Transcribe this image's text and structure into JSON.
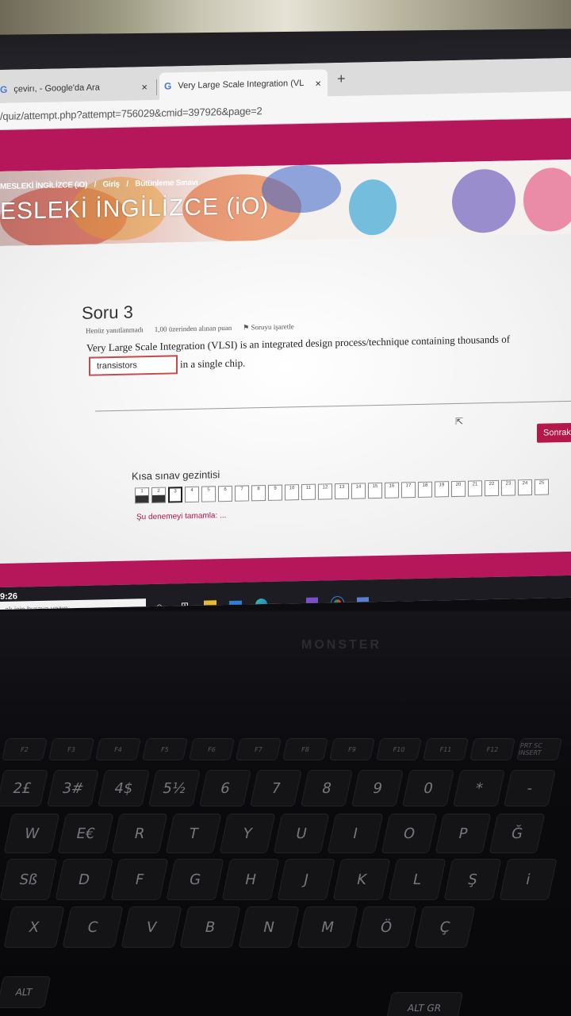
{
  "browser": {
    "tabs": [
      {
        "icon": "G",
        "label": "çevirı, - Google'da Ara",
        "close": "×"
      },
      {
        "icon": "G",
        "label": "Very Large Scale Integration (VLS",
        "close": "×"
      }
    ],
    "new_tab": "+",
    "url": "/quiz/attempt.php?attempt=756029&cmid=397926&page=2"
  },
  "course": {
    "breadcrumb": [
      "MESLEKİ İNGİLİZCE (iO)",
      "/",
      "Giriş",
      "/",
      "Bütünleme Sınavı"
    ],
    "title": "ESLEKİ İNGİLİZCE (iO)"
  },
  "question": {
    "title": "Soru 3",
    "status": "Henüz yanıtlanmadı",
    "points": "1,00 üzerinden alınan puan",
    "flag": "Soruyu işaretle",
    "text": "Very Large Scale Integration (VLSI) is an integrated design process/technique containing thousands of",
    "answer": "transistors",
    "text_after": "in a single chip."
  },
  "next_button": "Sonrak",
  "quiz_nav": {
    "title": "Kısa sınav gezintisi",
    "items": [
      {
        "n": "1",
        "state": "answered"
      },
      {
        "n": "2",
        "state": "answered"
      },
      {
        "n": "3",
        "state": "current"
      },
      {
        "n": "4",
        "state": "empty"
      },
      {
        "n": "5",
        "state": "empty"
      },
      {
        "n": "6",
        "state": "empty"
      },
      {
        "n": "7",
        "state": "empty"
      },
      {
        "n": "8",
        "state": "empty"
      },
      {
        "n": "9",
        "state": "empty"
      },
      {
        "n": "10",
        "state": "empty"
      },
      {
        "n": "11",
        "state": "empty"
      },
      {
        "n": "12",
        "state": "empty"
      },
      {
        "n": "13",
        "state": "empty"
      },
      {
        "n": "14",
        "state": "empty"
      },
      {
        "n": "15",
        "state": "empty"
      },
      {
        "n": "16",
        "state": "empty"
      },
      {
        "n": "17",
        "state": "empty"
      },
      {
        "n": "18",
        "state": "empty"
      },
      {
        "n": "19",
        "state": "empty"
      },
      {
        "n": "20",
        "state": "empty"
      },
      {
        "n": "21",
        "state": "empty"
      },
      {
        "n": "22",
        "state": "empty"
      },
      {
        "n": "23",
        "state": "empty"
      },
      {
        "n": "24",
        "state": "empty"
      },
      {
        "n": "25",
        "state": "empty"
      }
    ],
    "finish": "Şu denemeyi tamamla: ..."
  },
  "taskbar": {
    "clock": "9:26",
    "search_placeholder": "ak için buraya yazın",
    "icons": [
      "search-circle-icon",
      "task-view-icon",
      "file-explorer-icon",
      "mail-icon",
      "edge-icon",
      "dot-icon",
      "visual-studio-icon",
      "chrome-icon",
      "app-icon"
    ]
  },
  "laptop": {
    "brand": "MONSTER",
    "keys": {
      "fn_row": [
        "F2",
        "F3",
        "F4",
        "F5",
        "F6",
        "F7",
        "F8",
        "F9",
        "F10",
        "F11",
        "F12",
        "PRT SC INSERT"
      ],
      "num_row": [
        "2£",
        "3#",
        "4$",
        "5½",
        "6",
        "7",
        "8",
        "9",
        "0",
        "*",
        "-"
      ],
      "top_row": [
        "W",
        "E€",
        "R",
        "T",
        "Y",
        "U",
        "I",
        "O",
        "P",
        "Ğ"
      ],
      "home_row": [
        "Sß",
        "D",
        "F",
        "G",
        "H",
        "J",
        "K",
        "L",
        "Ş",
        "i"
      ],
      "bottom_row": [
        "X",
        "C",
        "V",
        "B",
        "N",
        "M",
        "Ö",
        "Ç"
      ],
      "modifiers": [
        "ALT",
        "ALT GR"
      ]
    }
  },
  "colors": {
    "accent": "#b5175a",
    "next_button": "#b5174a",
    "answer_border": "#c74a4a"
  }
}
